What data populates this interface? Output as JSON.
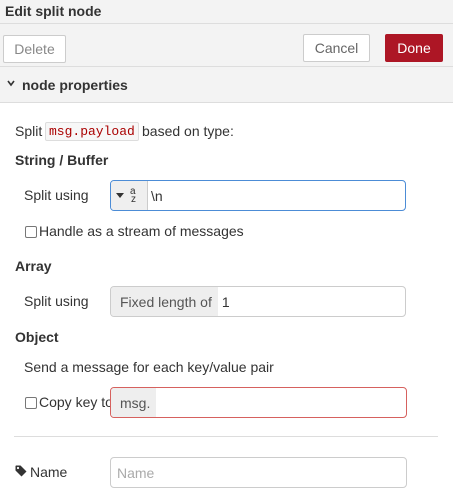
{
  "dialog": {
    "title": "Edit split node"
  },
  "toolbar": {
    "delete_label": "Delete",
    "cancel_label": "Cancel",
    "done_label": "Done"
  },
  "section": {
    "title": "node properties"
  },
  "intro": {
    "prefix": "Split",
    "code": "msg.payload",
    "suffix": "based on type:"
  },
  "string_buffer": {
    "heading": "String / Buffer",
    "split_label": "Split using",
    "split_type_glyph_top": "a",
    "split_type_glyph_bottom": "z",
    "split_value": "\\n",
    "stream_label": "Handle as a stream of messages",
    "stream_checked": false
  },
  "array": {
    "heading": "Array",
    "split_label": "Split using",
    "mode_label": "Fixed length of",
    "value": "1"
  },
  "object": {
    "heading": "Object",
    "info": "Send a message for each key/value pair",
    "copy_key_label": "Copy key to",
    "copy_key_checked": false,
    "copy_key_prefix": "msg.",
    "copy_key_value": ""
  },
  "name": {
    "label": "Name",
    "placeholder": "Name",
    "value": ""
  },
  "colors": {
    "accent": "#ad1625",
    "focus_border": "#4c8cd6",
    "error_border": "#d6615e"
  }
}
